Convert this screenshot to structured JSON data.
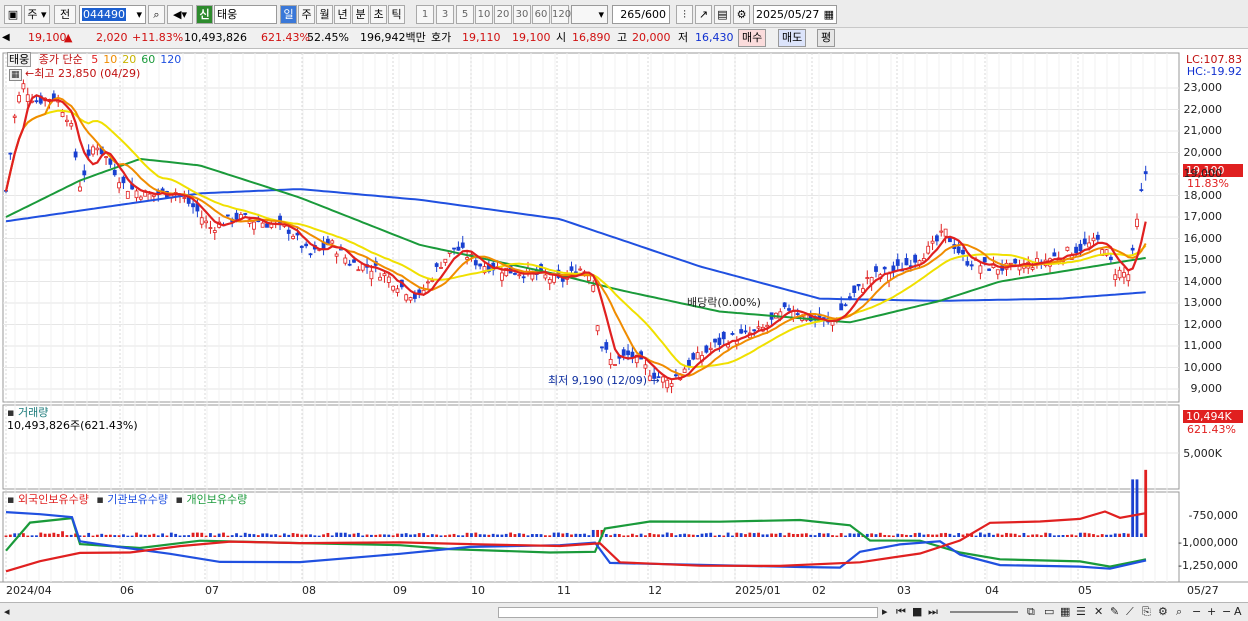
{
  "toolbar": {
    "market_label": "주",
    "prev_label": "전",
    "code": "044490",
    "new_badge": "신",
    "stock_name": "태웅",
    "period_buttons": [
      "일",
      "주",
      "월",
      "년",
      "분",
      "초",
      "틱"
    ],
    "interval_buttons": [
      "1",
      "3",
      "5",
      "10",
      "20",
      "30",
      "60",
      "120"
    ],
    "count": "265",
    "count_total": "/600",
    "date": "2025/05/27"
  },
  "quote": {
    "price": "19,100",
    "change_arrow": "▲",
    "change": "2,020",
    "change_pct": "+11.83%",
    "volume": "10,493,826",
    "volume_ratio": "621.43%",
    "turnover": "52.45%",
    "amount": "196,942백만",
    "bid_label": "호가",
    "bid": "19,110",
    "ask": "19,100",
    "open_label": "시",
    "open": "16,890",
    "high_label": "고",
    "high": "20,000",
    "low_label": "저",
    "low": "16,430",
    "buy_label": "매수",
    "sell_label": "매도",
    "eval_label": "평"
  },
  "price_panel": {
    "name": "태웅",
    "ma_label": "종가 단순",
    "ma_periods": [
      "5",
      "10",
      "20",
      "60",
      "120"
    ],
    "ma_colors": [
      "#e02020",
      "#f08c00",
      "#f0e000",
      "#1a9a3a",
      "#2050e0"
    ],
    "max_label": "←최고 23,850 (04/29)",
    "min_label": "최저 9,190 (12/09)",
    "dividend_label": "배당락(0.00%)",
    "lc": "LC:107.83",
    "hc": "HC:-19.92",
    "last_price": "19,100",
    "last_pct": "11.83%",
    "y_ticks": [
      "23,000",
      "22,000",
      "21,000",
      "20,000",
      "19,000",
      "18,000",
      "17,000",
      "16,000",
      "15,000",
      "14,000",
      "13,000",
      "12,000",
      "11,000",
      "10,000",
      "9,000"
    ]
  },
  "volume_panel": {
    "title": "거래량",
    "value": "10,493,826주(621.43%)",
    "last": "10,494K",
    "last_pct": "621.43%",
    "tick": "5,000K"
  },
  "holding_panel": {
    "series": [
      "외국인보유수량",
      "기관보유수량",
      "개인보유수량"
    ],
    "colors": [
      "#e02020",
      "#2050e0",
      "#1a9a3a"
    ],
    "ticks": [
      "-750,000",
      "-1,000,000",
      "-1,250,000"
    ]
  },
  "x_axis": [
    "2024/04",
    "06",
    "07",
    "08",
    "09",
    "10",
    "11",
    "12",
    "2025/01",
    "02",
    "03",
    "04",
    "05",
    "05/27"
  ],
  "scroll": {
    "zoom_label": "A"
  }
}
